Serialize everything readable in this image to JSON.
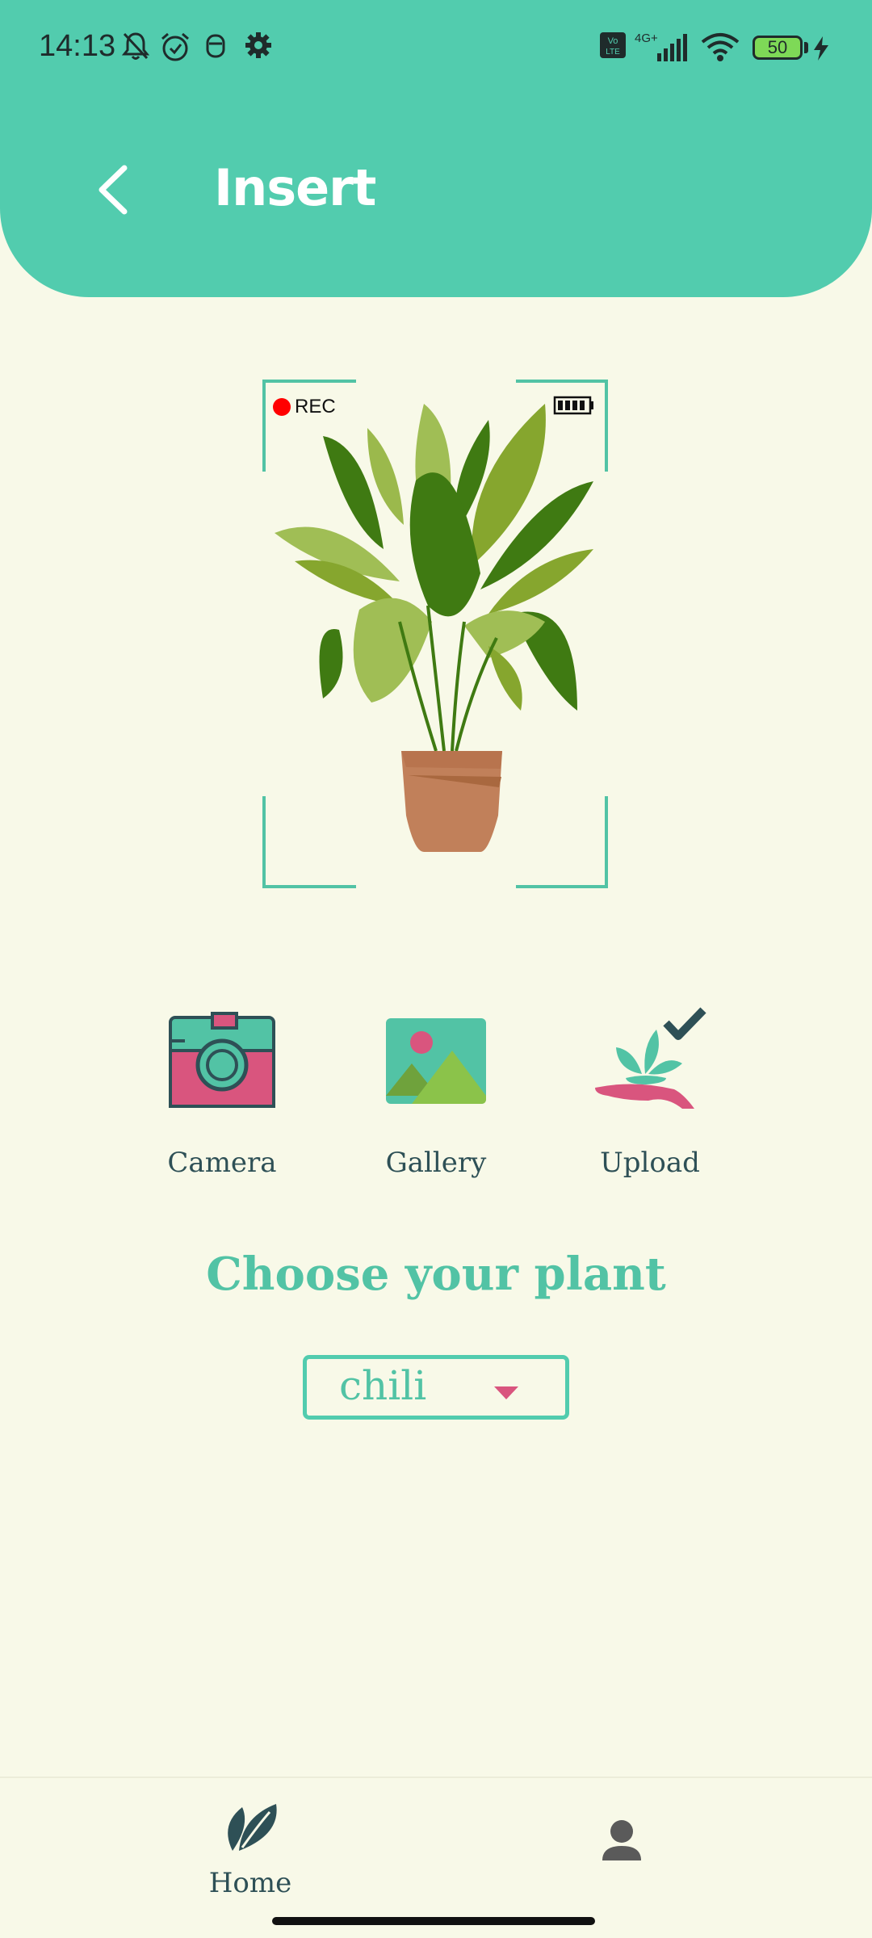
{
  "status_bar": {
    "time": "14:13",
    "battery_level": "50",
    "network": "4G+"
  },
  "header": {
    "title": "Insert",
    "back_icon": "chevron-left-icon",
    "background_color": "#52CCAE"
  },
  "viewfinder": {
    "rec_label": "REC",
    "illustration": "potted-plant"
  },
  "actions": [
    {
      "label": "Camera",
      "icon": "camera-icon"
    },
    {
      "label": "Gallery",
      "icon": "gallery-icon"
    },
    {
      "label": "Upload",
      "icon": "upload-plant-icon"
    }
  ],
  "choose": {
    "title": "Choose your plant",
    "selected_value": "chili"
  },
  "bottom_nav": {
    "home_label": "Home",
    "home_icon": "leaf-icon",
    "profile_icon": "person-icon"
  },
  "colors": {
    "accent": "#52CCAE",
    "text_dark": "#2E5056",
    "background": "#F8F9E8",
    "pink": "#D9557E"
  }
}
